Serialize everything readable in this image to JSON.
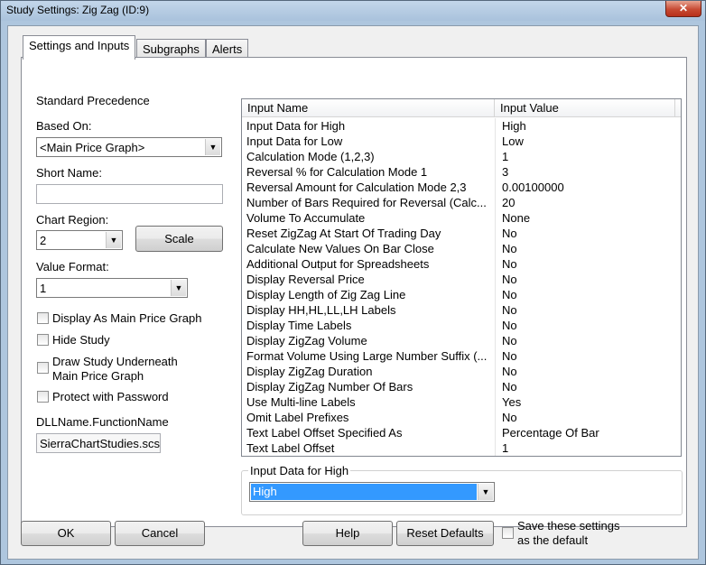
{
  "window": {
    "title": "Study Settings: Zig Zag (ID:9)",
    "close_glyph": "✕"
  },
  "tabs": [
    {
      "label": "Settings and Inputs",
      "active": true
    },
    {
      "label": "Subgraphs",
      "active": false
    },
    {
      "label": "Alerts",
      "active": false
    }
  ],
  "left": {
    "standard_precedence": "Standard Precedence",
    "based_on_label": "Based On:",
    "based_on_value": "<Main Price Graph>",
    "short_name_label": "Short Name:",
    "short_name_value": "",
    "chart_region_label": "Chart Region:",
    "chart_region_value": "2",
    "scale_button": "Scale",
    "value_format_label": "Value Format:",
    "value_format_value": "1",
    "checkboxes": [
      {
        "label": "Display As Main Price Graph",
        "checked": false
      },
      {
        "label": "Hide Study",
        "checked": false
      },
      {
        "label": "Draw Study Underneath",
        "label2": "Main Price Graph",
        "checked": false
      },
      {
        "label": "Protect with Password",
        "checked": false
      }
    ],
    "dll_label": "DLLName.FunctionName",
    "dll_value": "SierraChartStudies.scs"
  },
  "grid": {
    "header_name": "Input Name",
    "header_value": "Input Value",
    "rows": [
      {
        "name": "Input Data for High",
        "value": "High"
      },
      {
        "name": "Input Data for Low",
        "value": "Low"
      },
      {
        "name": "Calculation Mode (1,2,3)",
        "value": "1"
      },
      {
        "name": "Reversal % for Calculation Mode 1",
        "value": "3"
      },
      {
        "name": "Reversal Amount for Calculation Mode 2,3",
        "value": "0.00100000"
      },
      {
        "name": "Number of Bars Required for Reversal (Calc...",
        "value": "20"
      },
      {
        "name": "Volume To Accumulate",
        "value": "None"
      },
      {
        "name": "Reset ZigZag At Start Of Trading Day",
        "value": "No"
      },
      {
        "name": "Calculate New Values On Bar Close",
        "value": "No"
      },
      {
        "name": "Additional Output for Spreadsheets",
        "value": "No"
      },
      {
        "name": "Display Reversal Price",
        "value": "No"
      },
      {
        "name": "Display Length of Zig Zag Line",
        "value": "No"
      },
      {
        "name": "Display HH,HL,LL,LH Labels",
        "value": "No"
      },
      {
        "name": "Display Time Labels",
        "value": "No"
      },
      {
        "name": "Display ZigZag Volume",
        "value": "No"
      },
      {
        "name": "Format Volume Using Large Number Suffix (...",
        "value": "No"
      },
      {
        "name": "Display ZigZag Duration",
        "value": "No"
      },
      {
        "name": "Display ZigZag Number Of Bars",
        "value": "No"
      },
      {
        "name": "Use Multi-line Labels",
        "value": "Yes"
      },
      {
        "name": "Omit Label Prefixes",
        "value": "No"
      },
      {
        "name": "Text Label Offset Specified As",
        "value": "Percentage Of Bar"
      },
      {
        "name": "Text Label Offset",
        "value": "1"
      }
    ]
  },
  "editor": {
    "group_label": "Input Data for High",
    "selected_value": "High"
  },
  "bottom": {
    "ok": "OK",
    "cancel": "Cancel",
    "help": "Help",
    "reset": "Reset Defaults",
    "save_line1": "Save these settings",
    "save_line2": "as the default"
  },
  "colors": {
    "selection": "#3399ff",
    "frame": "#aec6de",
    "close": "#c74a33"
  }
}
